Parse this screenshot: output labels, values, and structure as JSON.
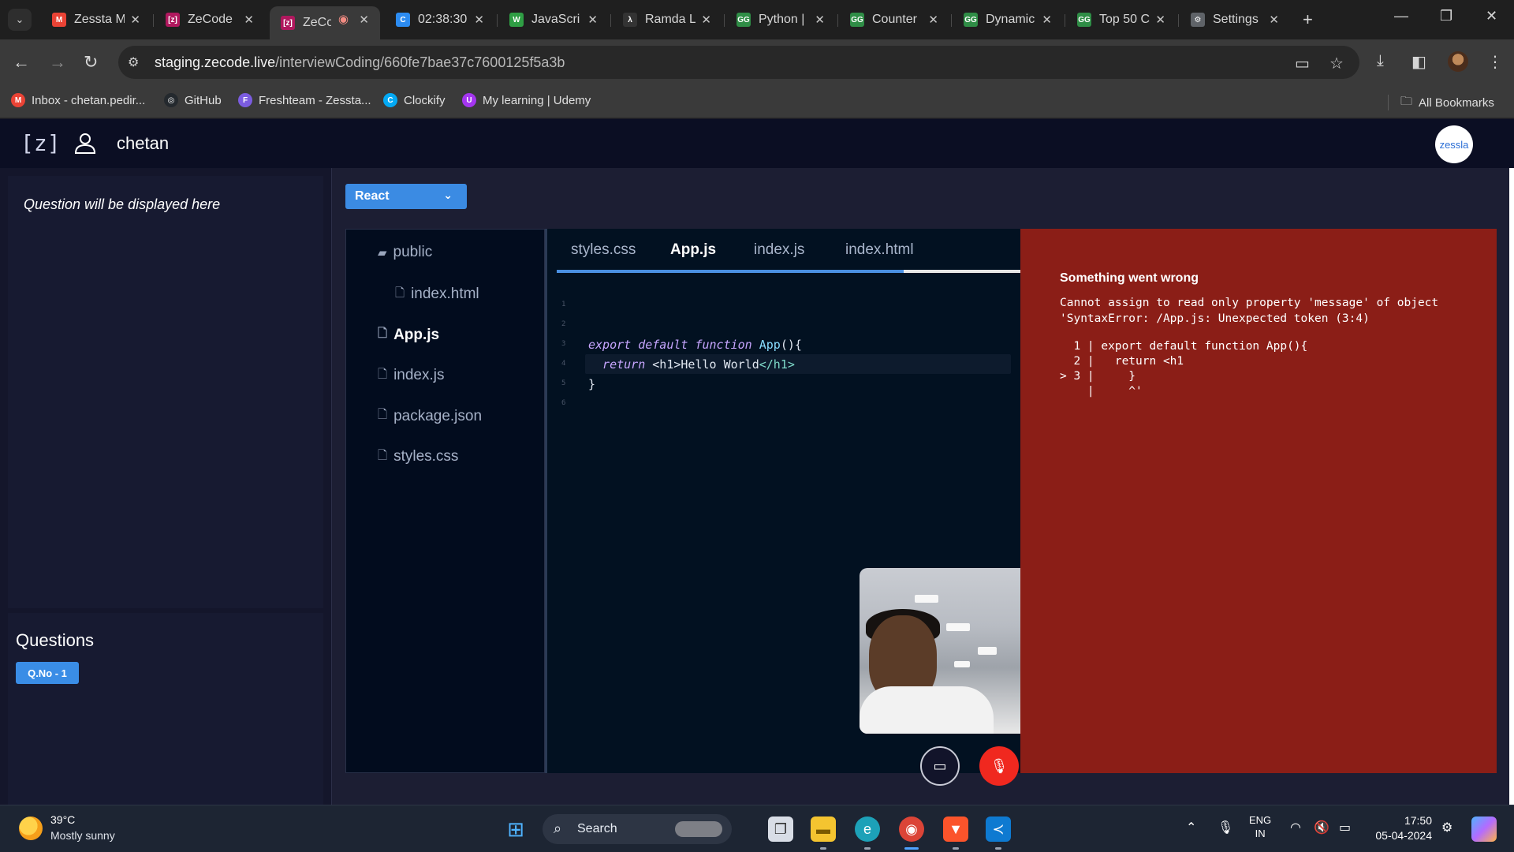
{
  "browser": {
    "tabs": [
      {
        "title": "Zessta M",
        "favicon": "M",
        "color": "#ea4335"
      },
      {
        "title": "ZeCode",
        "favicon": "[z]",
        "color": "#b0185e"
      },
      {
        "title": "ZeCo",
        "favicon": "[z]",
        "color": "#b0185e",
        "active": true,
        "recording": true
      },
      {
        "title": "02:38:30",
        "favicon": "C",
        "color": "#2c8cf2"
      },
      {
        "title": "JavaScri",
        "favicon": "W",
        "color": "#2f9e44"
      },
      {
        "title": "Ramda L",
        "favicon": "λ",
        "color": "#333333"
      },
      {
        "title": "Python |",
        "favicon": "GG",
        "color": "#2f8d46"
      },
      {
        "title": "Counter",
        "favicon": "GG",
        "color": "#2f8d46"
      },
      {
        "title": "Dynamic",
        "favicon": "GG",
        "color": "#2f8d46"
      },
      {
        "title": "Top 50 C",
        "favicon": "GG",
        "color": "#2f8d46"
      },
      {
        "title": "Settings",
        "favicon": "⚙",
        "color": "#5f6368"
      }
    ],
    "url_host": "staging.zecode.live",
    "url_path": "/interviewCoding/660fe7bae37c7600125f5a3b",
    "bookmarks": [
      {
        "label": "Inbox - chetan.pedir...",
        "color": "#ea4335",
        "glyph": "M"
      },
      {
        "label": "GitHub",
        "color": "#24292e",
        "glyph": "◎"
      },
      {
        "label": "Freshteam - Zessta...",
        "color": "#7b5ce0",
        "glyph": "F"
      },
      {
        "label": "Clockify",
        "color": "#03a9f4",
        "glyph": "C"
      },
      {
        "label": "My learning | Udemy",
        "color": "#a435f0",
        "glyph": "U"
      }
    ],
    "all_bookmarks": "All Bookmarks"
  },
  "app": {
    "brand": "[z]",
    "username": "chetan",
    "company_badge": "zessla",
    "question_placeholder": "Question will be displayed here",
    "questions_title": "Questions",
    "question_buttons": [
      "Q.No - 1"
    ],
    "language": "React"
  },
  "file_tree": [
    {
      "name": "public",
      "type": "folder",
      "indent": 0
    },
    {
      "name": "index.html",
      "type": "file",
      "indent": 1
    },
    {
      "name": "App.js",
      "type": "file",
      "indent": 0,
      "active": true
    },
    {
      "name": "index.js",
      "type": "file",
      "indent": 0
    },
    {
      "name": "package.json",
      "type": "file",
      "indent": 0
    },
    {
      "name": "styles.css",
      "type": "file",
      "indent": 0
    }
  ],
  "editor": {
    "tabs": [
      "styles.css",
      "App.js",
      "index.js",
      "index.html"
    ],
    "active_tab": "App.js",
    "line_numbers": [
      "1",
      "2",
      "3",
      "4",
      "5",
      "6"
    ]
  },
  "error": {
    "title": "Something went wrong",
    "message_line1": "Cannot assign to read only property 'message' of object",
    "message_line2": "'SyntaxError: /App.js: Unexpected token (3:4)",
    "code_frame": "  1 | export default function App(){\n  2 |   return <h1\n> 3 |     }\n    |     ^'"
  },
  "taskbar": {
    "temperature": "39°C",
    "weather": "Mostly sunny",
    "search": "Search",
    "lang_line1": "ENG",
    "lang_line2": "IN",
    "time": "17:50",
    "date": "05-04-2024"
  }
}
